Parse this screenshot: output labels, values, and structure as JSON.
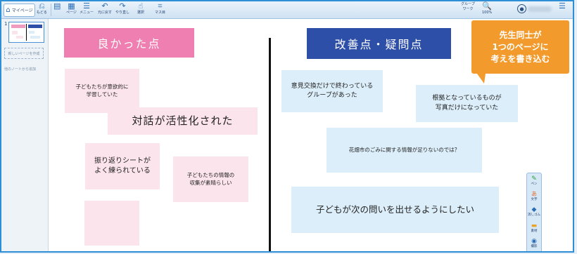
{
  "toolbar": {
    "mypage_label": "マイページ",
    "back_label": "もどる",
    "page_label": "ページ",
    "menu_label": "メニュー",
    "undo_label": "元に戻す",
    "redo_label": "やり直し",
    "select_label": "選択",
    "frame_label": "マス目",
    "group_work_label": "グループワーク",
    "zoom_label": "100%"
  },
  "sidebar": {
    "page_number": "1",
    "new_page_label": "新しいページを作成",
    "other_note_label": "他のノートから追加"
  },
  "canvas": {
    "good_heading": "良かった点",
    "improve_heading": "改善点・疑問点",
    "pink_notes": [
      "子どもたちが意欲的に\n学習していた",
      "対話が活性化された",
      "振り返りシートが\nよく練られている",
      "子どもたちの情報の\n収集が素晴らしい",
      ""
    ],
    "blue_notes": [
      "意見交換だけで終わっている\nグループがあった",
      "根拠となっているものが\n写真だけになっていた",
      "花畑市のごみに関する情報が足りないのでは？",
      "子どもが次の問いを出せるようにしたい"
    ],
    "callout_lines": [
      "先生同士が",
      "1つのページに",
      "考えを書き込む"
    ]
  },
  "right_tools": [
    {
      "label": "ペン",
      "icon": "pen-icon"
    },
    {
      "label": "文字",
      "icon": "text-icon"
    },
    {
      "label": "消しゴム",
      "icon": "eraser-icon"
    },
    {
      "label": "素材",
      "icon": "material-icon"
    },
    {
      "label": "撮影",
      "icon": "camera-icon"
    }
  ],
  "colors": {
    "accent": "#2e8fd6",
    "pink_heading": "#ef7fb0",
    "blue_heading": "#2d4fa8",
    "pink_note": "#fce4ec",
    "blue_note": "#dceefa",
    "callout": "#f39a2c"
  }
}
